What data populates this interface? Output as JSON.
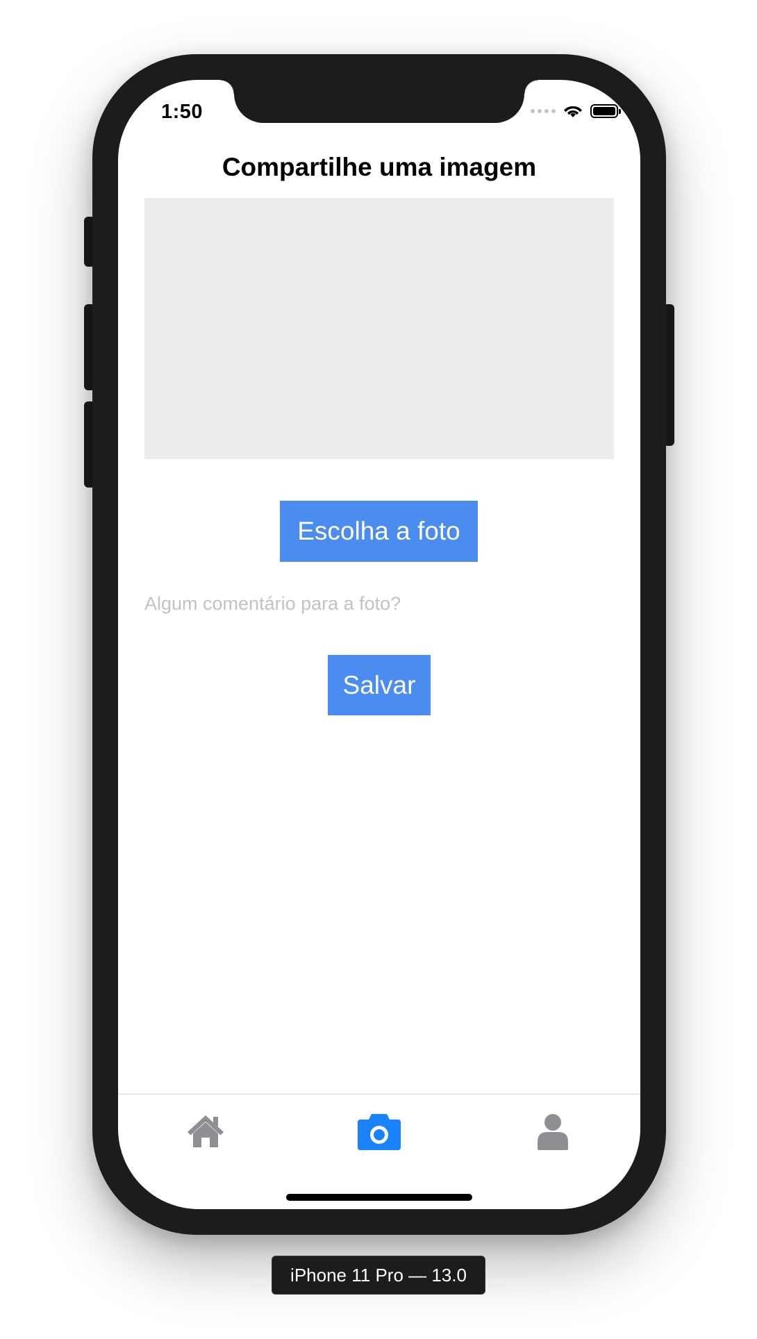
{
  "status_bar": {
    "time": "1:50"
  },
  "page": {
    "title": "Compartilhe uma imagem"
  },
  "actions": {
    "choose_photo_label": "Escolha a foto",
    "comment_placeholder": "Algum comentário para a foto?",
    "comment_value": "",
    "save_label": "Salvar"
  },
  "tab_bar": {
    "tabs": [
      {
        "icon": "home-icon",
        "active": false
      },
      {
        "icon": "camera-icon",
        "active": true
      },
      {
        "icon": "user-icon",
        "active": false
      }
    ],
    "active_color": "#1a82fb",
    "inactive_color": "#8e8e93"
  },
  "colors": {
    "button_background": "#4a8cf0",
    "placeholder_area": "#ededed"
  },
  "device_caption": "iPhone 11 Pro — 13.0"
}
